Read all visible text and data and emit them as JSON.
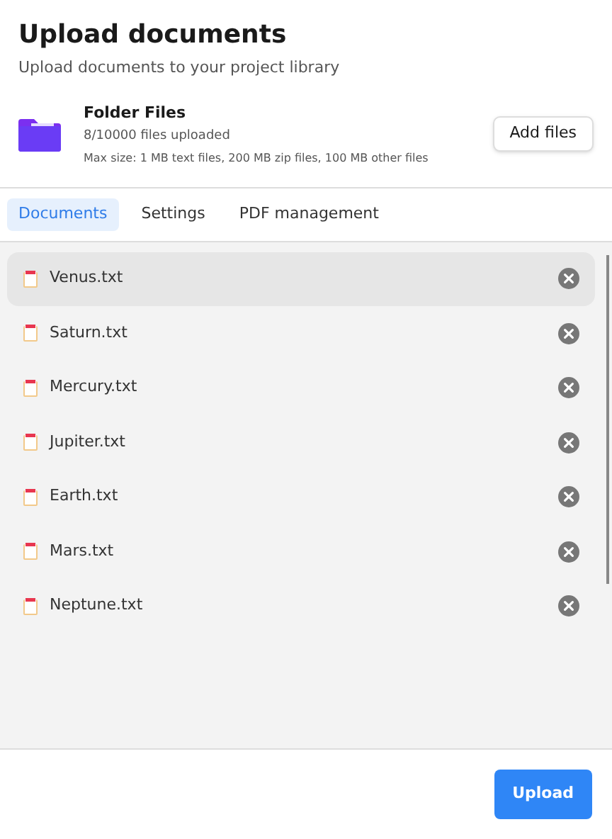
{
  "header": {
    "title": "Upload documents",
    "subtitle": "Upload documents to your project library"
  },
  "folder": {
    "name": "Folder Files",
    "count": "8/10000 files uploaded",
    "limits": "Max size: 1 MB text files, 200 MB zip files, 100 MB other files",
    "add_button": "Add files"
  },
  "tabs": [
    {
      "label": "Documents",
      "selected": true
    },
    {
      "label": "Settings",
      "selected": false
    },
    {
      "label": "PDF management",
      "selected": false
    }
  ],
  "files": [
    {
      "name": "Venus.txt",
      "selected": true
    },
    {
      "name": "Saturn.txt",
      "selected": false
    },
    {
      "name": "Mercury.txt",
      "selected": false
    },
    {
      "name": "Jupiter.txt",
      "selected": false
    },
    {
      "name": "Earth.txt",
      "selected": false
    },
    {
      "name": "Mars.txt",
      "selected": false
    },
    {
      "name": "Neptune.txt",
      "selected": false
    }
  ],
  "footer": {
    "upload_button": "Upload"
  }
}
